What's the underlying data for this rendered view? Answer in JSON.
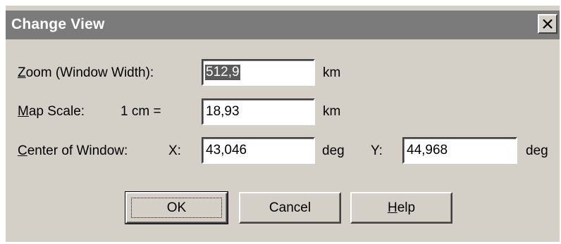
{
  "window": {
    "title": "Change View",
    "close_glyph": "×",
    "close_icon": "close-icon"
  },
  "zoom": {
    "label_access": "Z",
    "label_rest": "oom (Window Width):",
    "value": "512,9",
    "unit": "km"
  },
  "scale": {
    "label_access": "M",
    "label_rest": "ap Scale:",
    "prefix": "1 cm =",
    "value": "18,93",
    "unit": "km"
  },
  "center": {
    "label_access": "C",
    "label_rest": "enter of Window:",
    "x_label": "X:",
    "x_value": "43,046",
    "x_unit": "deg",
    "y_label": "Y:",
    "y_value": "44,968",
    "y_unit": "deg"
  },
  "buttons": {
    "ok": "OK",
    "cancel": "Cancel",
    "help_access": "H",
    "help_rest": "elp"
  },
  "colors": {
    "titlebar": "#7b7b7b",
    "dialog_face": "#d4d0c8",
    "selection": "#5a5a5a"
  }
}
